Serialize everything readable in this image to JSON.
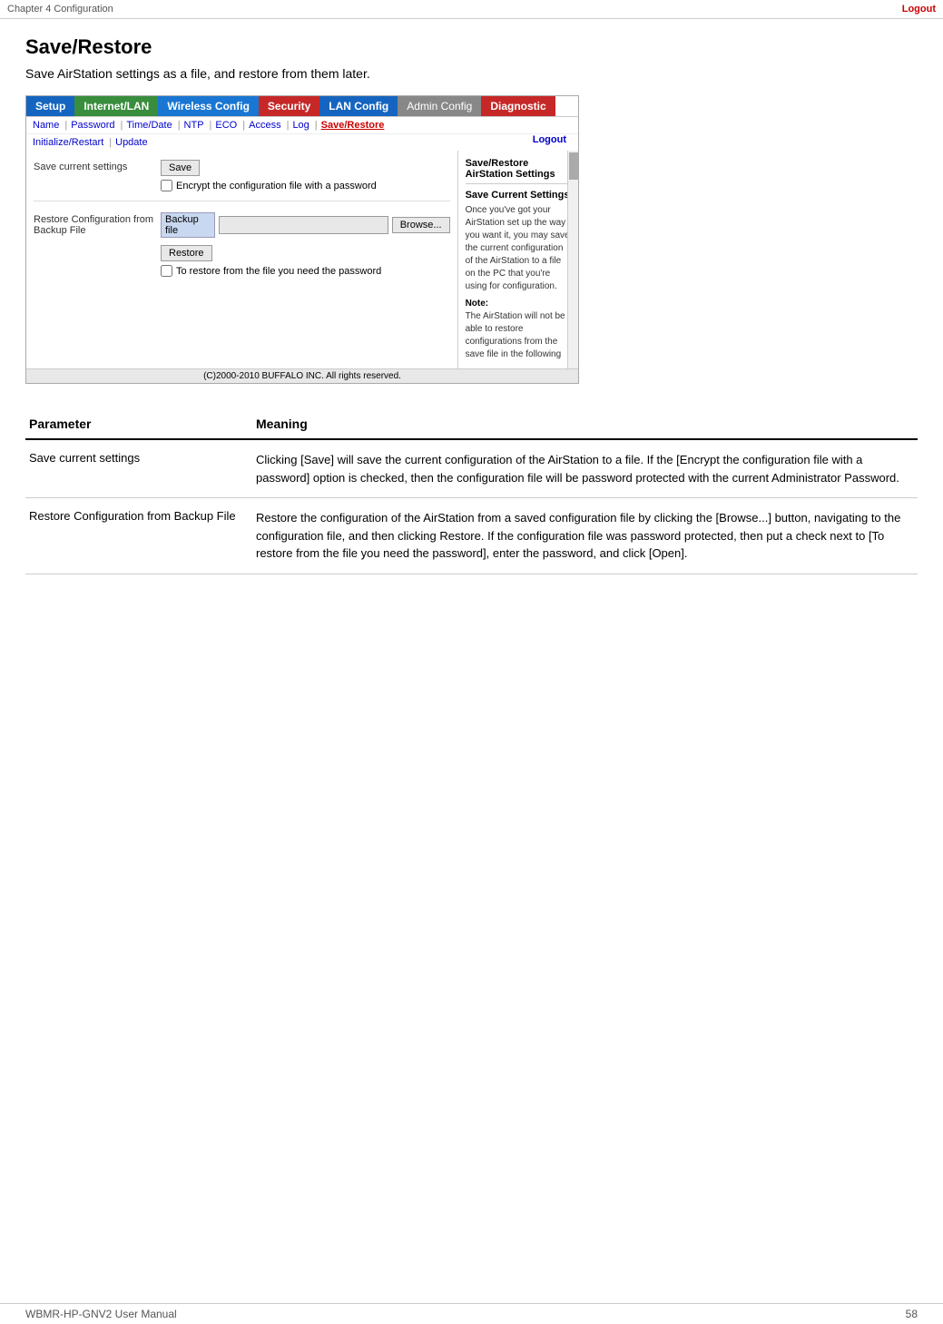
{
  "header": {
    "chapter": "Chapter 4  Configuration",
    "footer_left": "WBMR-HP-GNV2 User Manual",
    "footer_right": "58"
  },
  "page": {
    "title": "Save/Restore",
    "subtitle": "Save AirStation settings as a file, and restore from them later."
  },
  "nav": {
    "tabs": [
      {
        "id": "setup",
        "label": "Setup",
        "class": "tab-setup"
      },
      {
        "id": "internet",
        "label": "Internet/LAN",
        "class": "tab-internet"
      },
      {
        "id": "wireless",
        "label": "Wireless Config",
        "class": "tab-wireless"
      },
      {
        "id": "security",
        "label": "Security",
        "class": "tab-security"
      },
      {
        "id": "lan",
        "label": "LAN Config",
        "class": "tab-lan"
      },
      {
        "id": "admin",
        "label": "Admin Config",
        "class": "tab-admin"
      },
      {
        "id": "diagnostic",
        "label": "Diagnostic",
        "class": "tab-diagnostic"
      }
    ],
    "sub_links_row1": [
      "Name",
      "Password",
      "Time/Date",
      "NTP",
      "ECO",
      "Access",
      "Log"
    ],
    "sub_links_row2": [
      "Initialize/Restart",
      "Update"
    ],
    "active_link": "Save/Restore",
    "logout": "Logout"
  },
  "form": {
    "save_row": {
      "label": "Save current settings",
      "save_button": "Save",
      "encrypt_checkbox_label": "Encrypt the configuration file with a password"
    },
    "restore_row": {
      "label": "Restore Configuration from Backup File",
      "backup_label": "Backup file",
      "browse_button": "Browse...",
      "restore_button": "Restore",
      "password_checkbox_label": "To restore from the file you need the password"
    },
    "copyright": "(C)2000-2010 BUFFALO INC. All rights reserved."
  },
  "right_panel": {
    "title": "Save/Restore AirStation Settings",
    "section_title": "Save Current Settings",
    "text": "Once you've got your AirStation set up the way you want it, you may save the current configuration of the AirStation to a file on the PC that you're using for configuration.",
    "note_title": "Note:",
    "note_text": "The AirStation will not be able to restore configurations from the save file in the following"
  },
  "parameters": [
    {
      "name": "Save current settings",
      "meaning": "Clicking [Save] will save the current configuration of the AirStation to a file. If the [Encrypt the configuration file with a password] option is checked, then the configuration file will be password protected with the current Administrator Password."
    },
    {
      "name": "Restore Configuration from Backup File",
      "meaning": "Restore the configuration of the AirStation from a saved configuration file by clicking the [Browse...] button, navigating to the configuration file, and then clicking Restore. If the configuration file was password protected, then put a check next to [To restore from the file you need the password], enter the password, and click [Open]."
    }
  ]
}
